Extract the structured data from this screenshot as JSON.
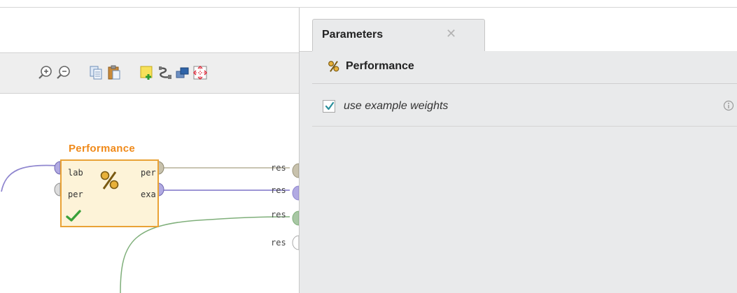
{
  "parameters_panel": {
    "tab_label": "Parameters",
    "tab_close_glyph": "✕",
    "operator_name": "Performance",
    "params": [
      {
        "label": "use example weights",
        "checked": true
      }
    ]
  },
  "process": {
    "toolbar": {
      "icons": [
        "zoom-in-icon",
        "zoom-out-icon",
        "copy-icon",
        "paste-icon",
        "add-note-icon",
        "auto-wire-icon",
        "bring-to-front-icon",
        "fit-view-icon"
      ]
    },
    "operator": {
      "name": "Performance",
      "input_ports": [
        "lab",
        "per"
      ],
      "output_ports": [
        "per",
        "exa"
      ],
      "status": "ok"
    },
    "result_ports": [
      "res",
      "res",
      "res",
      "res"
    ]
  },
  "colors": {
    "operator_title": "#f08a1a",
    "operator_border": "#e9a236",
    "operator_fill": "#fdf3d8",
    "wire_purple": "#8f86cf",
    "wire_green": "#7faf7a",
    "wire_tan": "#b7b199",
    "check_green": "#3aa13a"
  }
}
